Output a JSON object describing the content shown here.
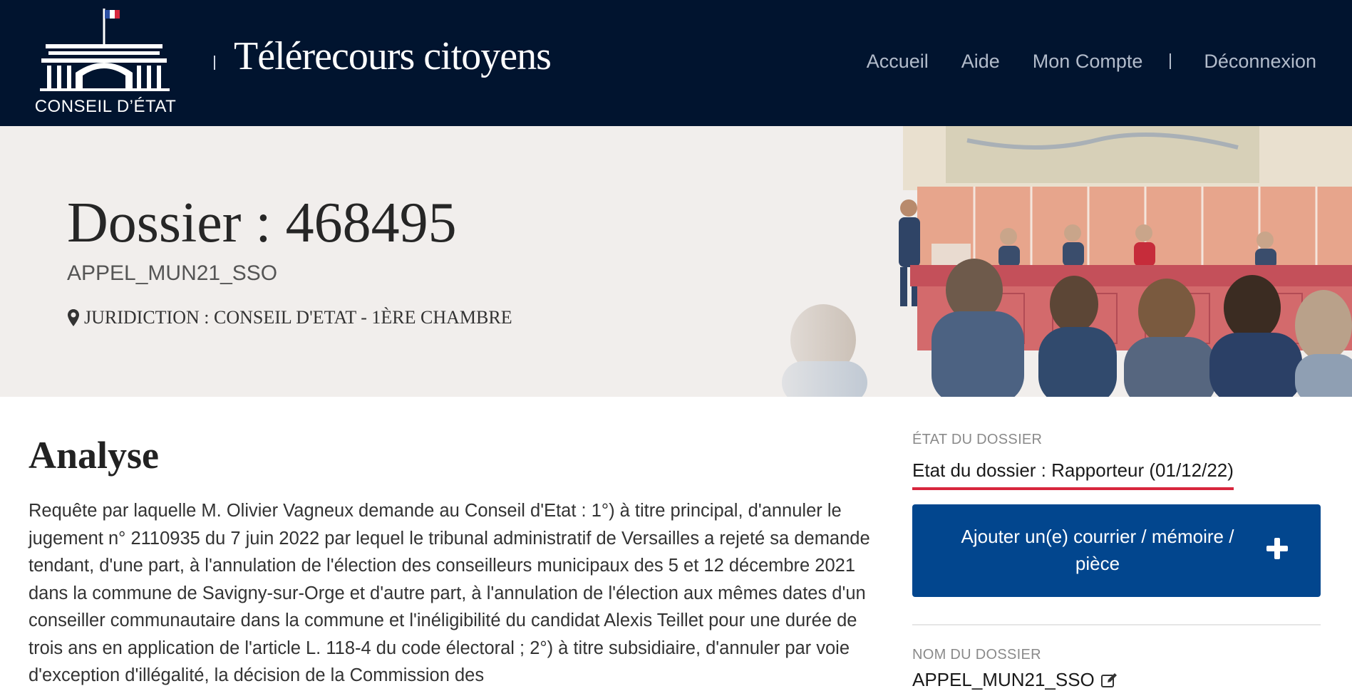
{
  "header": {
    "logo_text": "CONSEIL D’ÉTAT",
    "site_title": "Télérecours citoyens",
    "nav": {
      "accueil": "Accueil",
      "aide": "Aide",
      "mon_compte": "Mon Compte",
      "deconnexion": "Déconnexion"
    }
  },
  "banner": {
    "title": "Dossier : 468495",
    "code": "APPEL_MUN21_SSO",
    "juridiction": "JURIDICTION : CONSEIL D'ETAT - 1ÈRE CHAMBRE"
  },
  "analyse": {
    "heading": "Analyse",
    "text": "Requête par laquelle M. Olivier Vagneux demande au Conseil d'Etat : 1°) à titre principal, d'annuler le jugement n° 2110935 du 7 juin 2022 par lequel le tribunal administratif de Versailles a rejeté sa demande tendant, d'une part, à l'annulation de l'élection des conseilleurs municipaux des 5 et 12 décembre 2021 dans la commune de Savigny-sur-Orge et d'autre part, à l'annulation de l'élection aux mêmes dates d'un conseiller communautaire dans la commune et l'inéligibilité du candidat Alexis Teillet pour une durée de trois ans en application de l'article L. 118-4 du code électoral ; 2°) à titre subsidiaire, d'annuler par voie d'exception d'illégalité, la décision de la Commission des"
  },
  "sidebar": {
    "etat_label": "ÉTAT DU DOSSIER",
    "etat_value": "Etat du dossier : Rapporteur (01/12/22)",
    "add_button_label": "Ajouter un(e) courrier / mémoire / pièce",
    "nom_label": "NOM DU DOSSIER",
    "nom_value": "APPEL_MUN21_SSO"
  },
  "colors": {
    "header_bg": "#01142f",
    "banner_bg": "#f1eeec",
    "button_bg": "#02468e",
    "status_underline": "#d7263d"
  }
}
